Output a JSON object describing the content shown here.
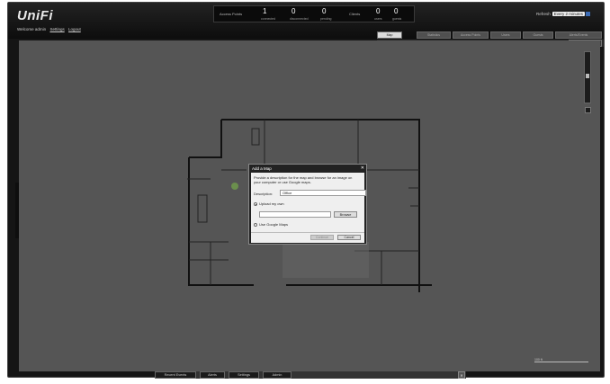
{
  "app": {
    "logo": "UniFi"
  },
  "subnav": {
    "prefix": "Welcome admin",
    "links": [
      "Settings",
      "Logout"
    ]
  },
  "stats": {
    "access_points_label": "Access Points",
    "clients_label": "Clients",
    "ap": [
      {
        "value": "1",
        "label": "connected"
      },
      {
        "value": "0",
        "label": "disconnected"
      },
      {
        "value": "0",
        "label": "pending"
      }
    ],
    "clients": [
      {
        "value": "0",
        "label": "users"
      },
      {
        "value": "0",
        "label": "guests"
      }
    ]
  },
  "refresh": {
    "label": "Refresh",
    "value": "Every 2 minutes"
  },
  "tabs": [
    "Map",
    "Statistics",
    "Access Points",
    "Users",
    "Guests",
    "Alerts/Events"
  ],
  "toolbar": {
    "show_label": "Show:",
    "items": [
      "Labels",
      "Details",
      "Coverage",
      "Topology"
    ],
    "map_label": "Map:",
    "map_value": "Sample",
    "configure_button": "Configure Maps"
  },
  "dialog": {
    "title": "Add a Map",
    "close": "✕",
    "description": "Provide a description for the map and browse for an image on your computer or use Google maps.",
    "description_label": "Description:",
    "description_value": "Office",
    "upload_option": "Upload my own",
    "browse_button": "Browse",
    "google_option": "Use Google Maps",
    "continue_button": "Continue",
    "cancel_button": "Cancel"
  },
  "bottombar": {
    "items": [
      "Recent Events",
      "Alerts",
      "Settings",
      "Admin"
    ],
    "close": "✕"
  },
  "map": {
    "scale": "100 ft"
  }
}
